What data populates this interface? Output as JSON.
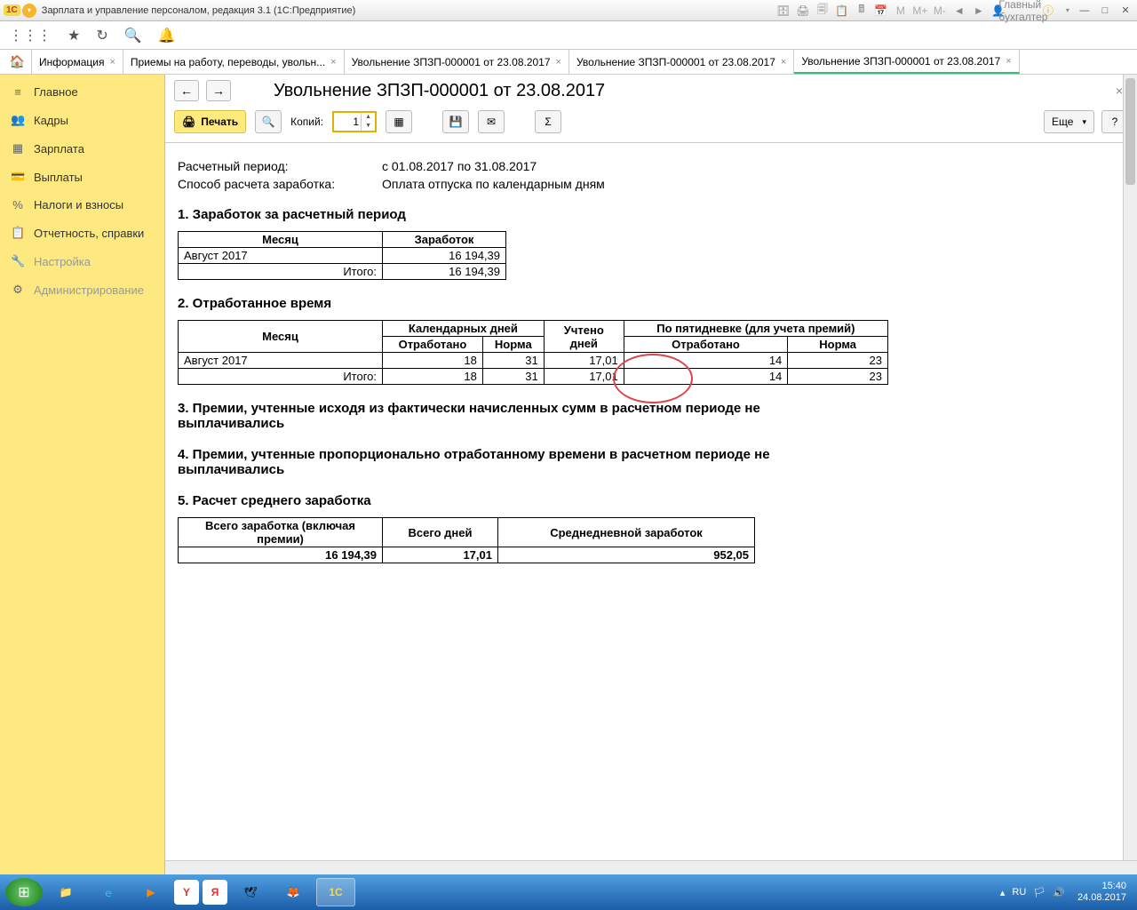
{
  "titlebar": {
    "app_title": "Зарплата и управление персоналом, редакция 3.1  (1С:Предприятие)",
    "user": "Главный бухгалтер"
  },
  "tabs": {
    "t0": "Информация",
    "t1": "Приемы на работу, переводы, увольн...",
    "t2": "Увольнение ЗПЗП-000001 от 23.08.2017",
    "t3": "Увольнение ЗПЗП-000001 от 23.08.2017",
    "t4": "Увольнение ЗПЗП-000001 от 23.08.2017"
  },
  "sidebar": {
    "main": "Главное",
    "kadry": "Кадры",
    "zarplata": "Зарплата",
    "vyplaty": "Выплаты",
    "nalogi": "Налоги и взносы",
    "otchet": "Отчетность, справки",
    "nastroika": "Настройка",
    "admin": "Администрирование"
  },
  "doc": {
    "title": "Увольнение ЗПЗП-000001 от 23.08.2017",
    "print": "Печать",
    "copies_label": "Копий:",
    "copies_value": "1",
    "more": "Еще",
    "help": "?"
  },
  "report": {
    "period_label": "Расчетный период:",
    "period_value": "с 01.08.2017 по 31.08.2017",
    "method_label": "Способ расчета заработка:",
    "method_value": "Оплата отпуска по календарным дням",
    "h1": "1. Заработок за расчетный период",
    "t1": {
      "hdr_month": "Месяц",
      "hdr_earn": "Заработок",
      "row_month": "Август 2017",
      "row_earn": "16 194,39",
      "total_label": "Итого:",
      "total_earn": "16 194,39"
    },
    "h2": "2. Отработанное время",
    "t2": {
      "hdr_month": "Месяц",
      "hdr_cal": "Календарных дней",
      "hdr_uchet": "Учтено дней",
      "hdr_pyat": "По пятидневке (для учета премий)",
      "hdr_otr": "Отработано",
      "hdr_norm": "Норма",
      "row_month": "Август 2017",
      "r_cal_otr": "18",
      "r_cal_norm": "31",
      "r_uchet": "17,01",
      "r_p_otr": "14",
      "r_p_norm": "23",
      "total_label": "Итого:",
      "t_cal_otr": "18",
      "t_cal_norm": "31",
      "t_uchet": "17,01",
      "t_p_otr": "14",
      "t_p_norm": "23"
    },
    "h3": "3. Премии, учтенные исходя из фактически начисленных сумм в расчетном периоде не выплачивались",
    "h4": "4. Премии, учтенные пропорционально отработанному времени в расчетном периоде не выплачивались",
    "h5": "5. Расчет среднего  заработка",
    "t5": {
      "hdr_total_earn": "Всего заработка (включая премии)",
      "hdr_total_days": "Всего дней",
      "hdr_avg": "Среднедневной заработок",
      "v_earn": "16 194,39",
      "v_days": "17,01",
      "v_avg": "952,05"
    }
  },
  "taskbar": {
    "lang": "RU",
    "time": "15:40",
    "date": "24.08.2017"
  }
}
